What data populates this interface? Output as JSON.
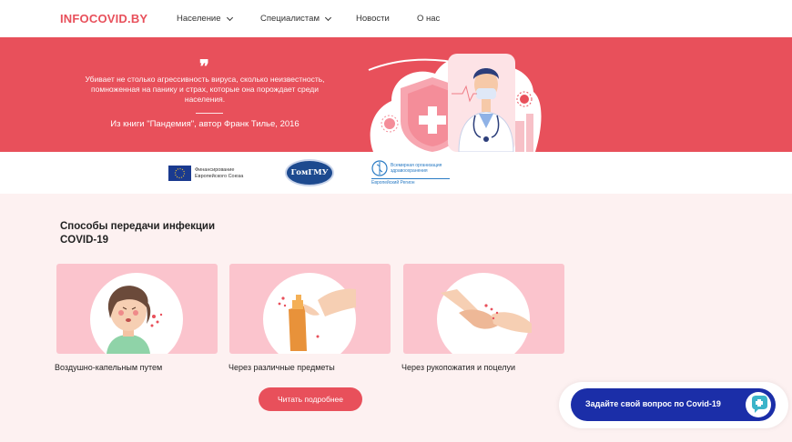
{
  "header": {
    "logo": "INFOCOVID.BY",
    "nav": [
      {
        "label": "Население",
        "dropdown": true
      },
      {
        "label": "Специалистам",
        "dropdown": true
      },
      {
        "label": "Новости",
        "dropdown": false
      },
      {
        "label": "О нас",
        "dropdown": false
      }
    ]
  },
  "hero": {
    "quote_mark": "❞",
    "quote": "Убивает не столько агрессивность вируса, сколько неизвестность, помноженная на панику и страх, которые она порождает среди населения.",
    "source": "Из книги \"Пандемия\", автор Франк Тилье, 2016",
    "bg_color": "#e8505b"
  },
  "partners": {
    "eu": "Финансирование Европейского Союза",
    "gomgmu": "ГомГМУ",
    "who": "Всемирная организация здравоохранения",
    "who_region": "Европейский Регион"
  },
  "section": {
    "title": "Способы передачи инфекции COVID-19",
    "cards": [
      {
        "label": "Воздушно-капельным путем",
        "icon": "sneezing-person-icon"
      },
      {
        "label": "Через различные предметы",
        "icon": "spray-hand-icon"
      },
      {
        "label": "Через рукопожатия и поцелуи",
        "icon": "handshake-icon"
      }
    ],
    "read_more": "Читать подробнее"
  },
  "chat": {
    "label": "Задайте свой вопрос по Covid-19",
    "icon": "chat-plus-icon",
    "color": "#1b2ea8"
  }
}
